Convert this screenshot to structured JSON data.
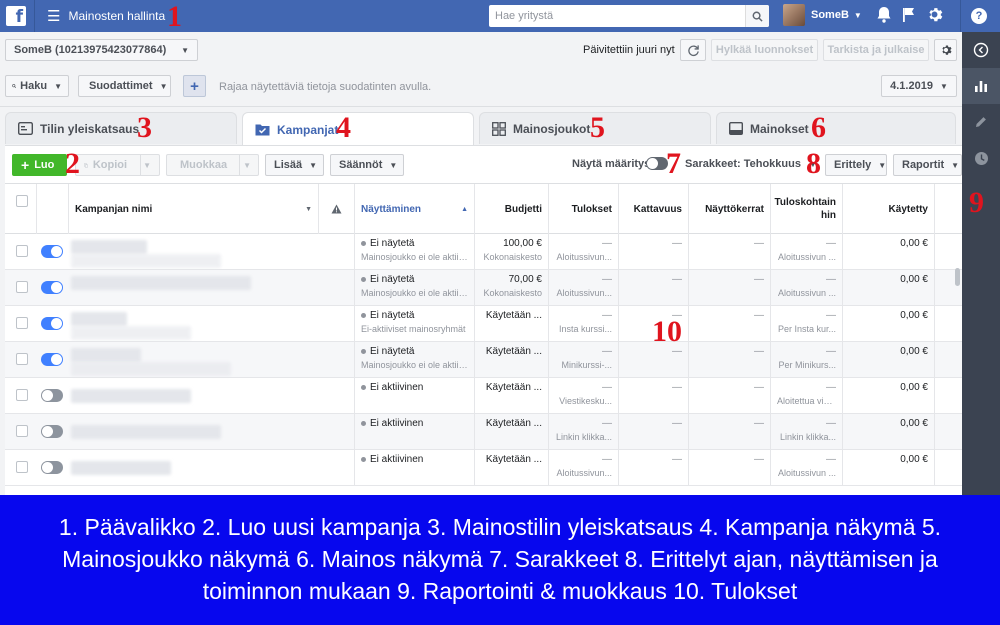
{
  "topbar": {
    "logo": "f",
    "title": "Mainosten hallinta",
    "search_placeholder": "Hae yritystä",
    "user_name": "SomeB"
  },
  "account": {
    "selector": "SomeB (10213975423077864)",
    "updated_text": "Päivitettiin juuri nyt",
    "discard_label": "Hylkää luonnokset",
    "review_label": "Tarkista ja julkaise"
  },
  "filters": {
    "search_label": "Haku",
    "filters_label": "Suodattimet",
    "add_label": "+",
    "hint": "Rajaa näytettäviä tietoja suodatinten avulla.",
    "date": "4.1.2019"
  },
  "tabs": [
    {
      "label": "Tilin yleiskatsaus"
    },
    {
      "label": "Kampanjat"
    },
    {
      "label": "Mainosjoukot"
    },
    {
      "label": "Mainokset"
    }
  ],
  "toolbar": {
    "create_label": "Luo",
    "copy_label": "Kopioi",
    "edit_label": "Muokkaa",
    "more_label": "Lisää",
    "rules_label": "Säännöt",
    "show_definitions": "Näytä määritys",
    "columns_label": "Sarakkeet: Tehokkuus",
    "breakdown_label": "Erittely",
    "reports_label": "Raportit"
  },
  "table": {
    "headers": {
      "name": "Kampanjan nimi",
      "delivery": "Näyttäminen",
      "budget": "Budjetti",
      "results": "Tulokset",
      "reach": "Kattavuus",
      "impressions": "Näyttökerrat",
      "cost_per_result": "Tuloskohtain hin",
      "spent": "Käytetty"
    },
    "rows": [
      {
        "delivery": "Ei näytetä",
        "delivery_sub": "Mainosjoukko ei ole aktiivinen",
        "budget": "100,00 €",
        "budget_sub": "Kokonaiskesto",
        "results": "—",
        "results_sub": "Aloitussivun...",
        "reach": "—",
        "impressions": "—",
        "cpr": "—",
        "cpr_sub": "Aloitussivun ...",
        "spent": "0,00 €"
      },
      {
        "delivery": "Ei näytetä",
        "delivery_sub": "Mainosjoukko ei ole aktiivinen",
        "budget": "70,00 €",
        "budget_sub": "Kokonaiskesto",
        "results": "—",
        "results_sub": "Aloitussivun...",
        "reach": "—",
        "impressions": "—",
        "cpr": "—",
        "cpr_sub": "Aloitussivun ...",
        "spent": "0,00 €"
      },
      {
        "delivery": "Ei näytetä",
        "delivery_sub": "Ei-aktiiviset mainosryhmät",
        "budget": "Käytetään ...",
        "budget_sub": "",
        "results": "—",
        "results_sub": "Insta kurssi...",
        "reach": "—",
        "impressions": "—",
        "cpr": "—",
        "cpr_sub": "Per Insta kur...",
        "spent": "0,00 €"
      },
      {
        "delivery": "Ei näytetä",
        "delivery_sub": "Mainosjoukko ei ole aktiivinen",
        "budget": "Käytetään ...",
        "budget_sub": "",
        "results": "—",
        "results_sub": "Minikurssi-...",
        "reach": "—",
        "impressions": "—",
        "cpr": "—",
        "cpr_sub": "Per Minikurs...",
        "spent": "0,00 €"
      },
      {
        "delivery": "Ei aktiivinen",
        "delivery_sub": "",
        "budget": "Käytetään ...",
        "budget_sub": "",
        "results": "—",
        "results_sub": "Viestikesku...",
        "reach": "—",
        "impressions": "—",
        "cpr": "—",
        "cpr_sub": "Aloitettua vie...",
        "spent": "0,00 €"
      },
      {
        "delivery": "Ei aktiivinen",
        "delivery_sub": "",
        "budget": "Käytetään ...",
        "budget_sub": "",
        "results": "—",
        "results_sub": "Linkin klikka...",
        "reach": "—",
        "impressions": "—",
        "cpr": "—",
        "cpr_sub": "Linkin klikka...",
        "spent": "0,00 €"
      },
      {
        "delivery": "Ei aktiivinen",
        "delivery_sub": "",
        "budget": "Käytetään ...",
        "budget_sub": "",
        "results": "—",
        "results_sub": "Aloitussivun...",
        "reach": "—",
        "impressions": "—",
        "cpr": "—",
        "cpr_sub": "Aloitussivun ...",
        "spent": "0,00 €"
      }
    ]
  },
  "annotations": [
    "1",
    "2",
    "3",
    "4",
    "5",
    "6",
    "7",
    "8",
    "9",
    "10"
  ],
  "caption": "1. Päävalikko  2. Luo uusi kampanja  3. Mainostilin yleiskatsaus  4. Kampanja näkymä  5. Mainosjoukko näkymä  6. Mainos näkymä  7. Sarakkeet  8. Erittelyt ajan, näyttämisen ja toiminnon mukaan  9. Raportointi & muokkaus  10. Tulokset",
  "colors": {
    "brand": "#4267b2",
    "create": "#42b72a",
    "toggle_on": "#4080ff",
    "annotation": "#e0141e",
    "caption_bg": "#0707ee"
  }
}
